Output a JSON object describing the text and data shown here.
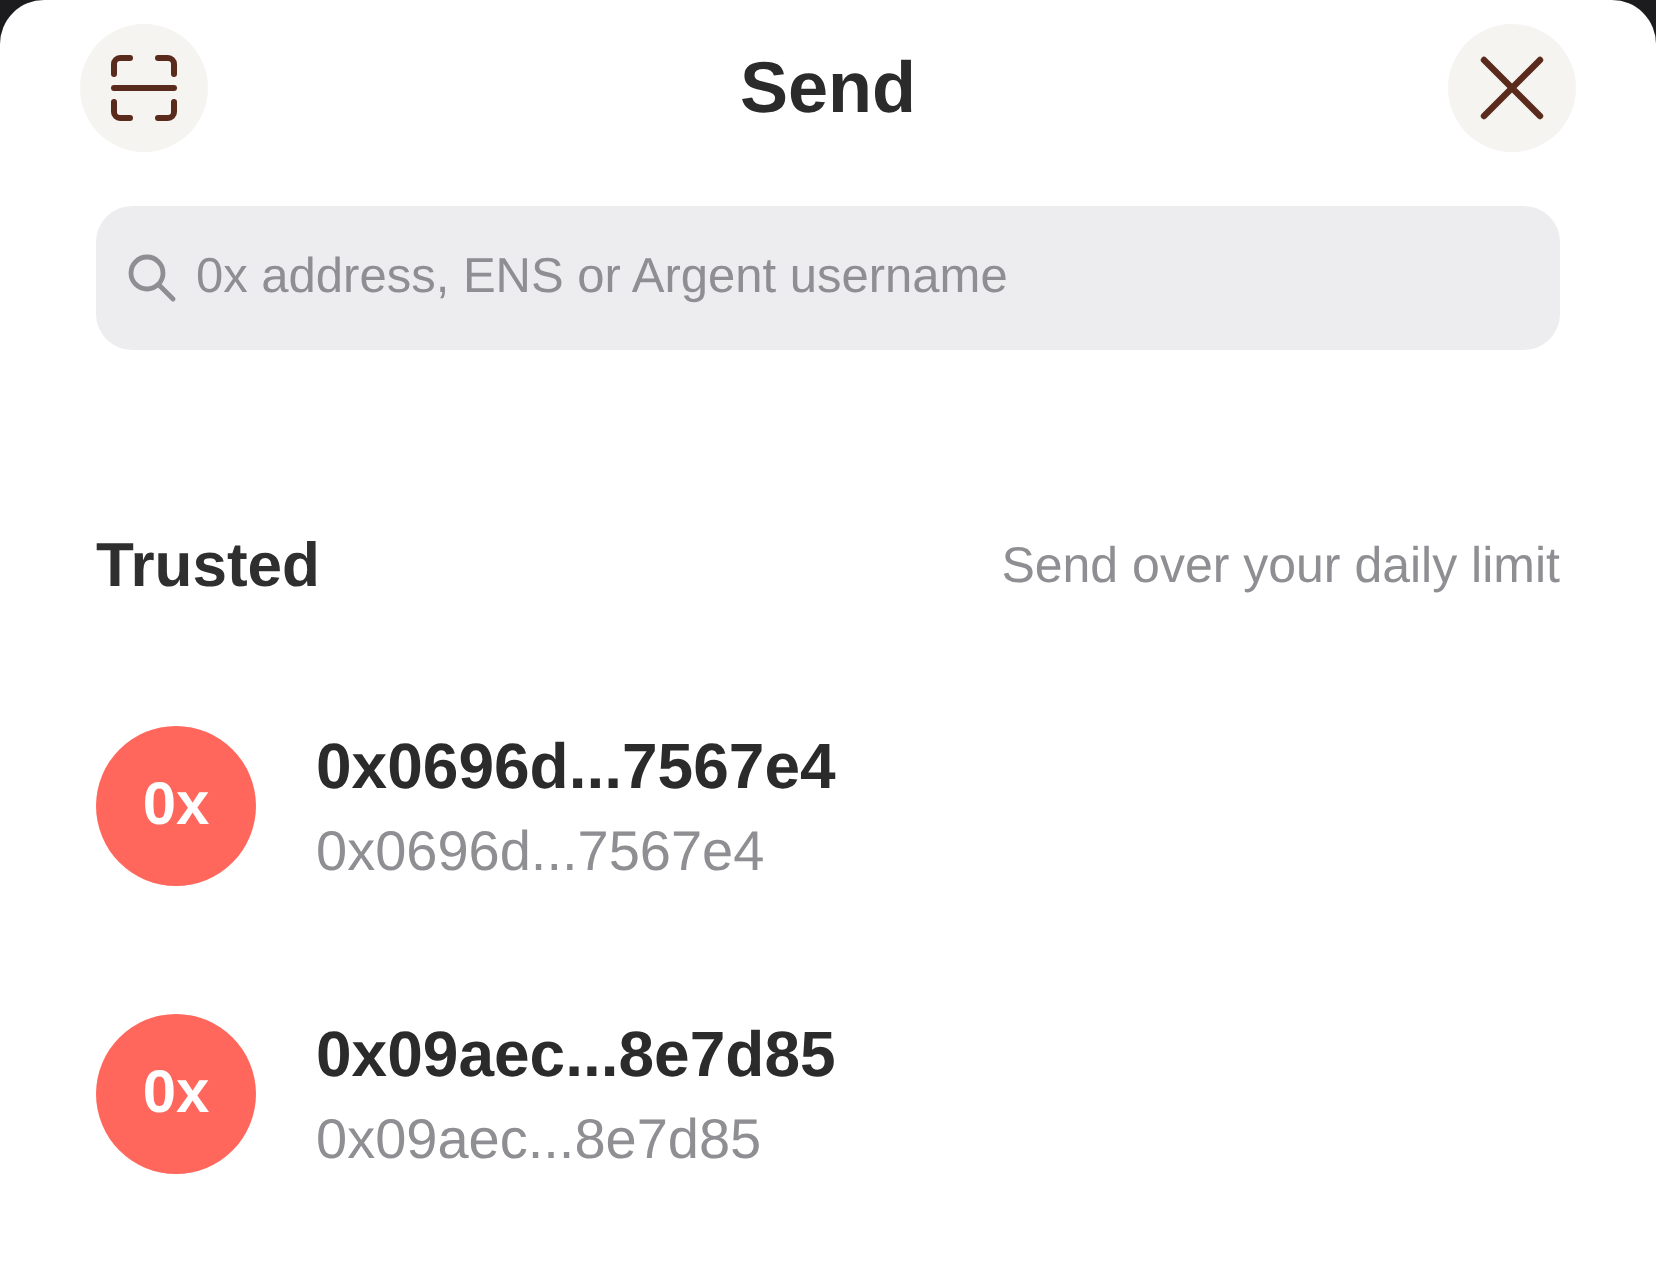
{
  "header": {
    "title": "Send"
  },
  "search": {
    "placeholder": "0x address, ENS or Argent username"
  },
  "section": {
    "title": "Trusted",
    "note": "Send over your daily limit"
  },
  "contacts": [
    {
      "avatar": "0x",
      "name": "0x0696d...7567e4",
      "address": "0x0696d...7567e4"
    },
    {
      "avatar": "0x",
      "name": "0x09aec...8e7d85",
      "address": "0x09aec...8e7d85"
    }
  ]
}
